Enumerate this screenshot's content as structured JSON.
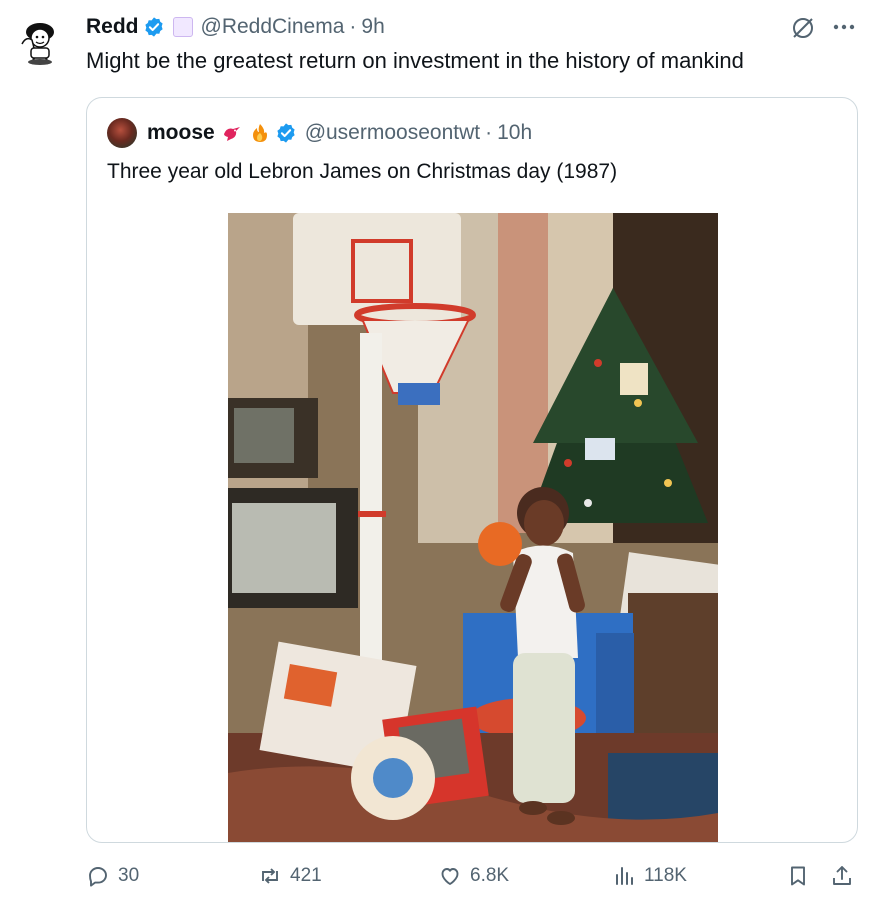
{
  "tweet": {
    "author_name": "Redd",
    "handle": "@ReddCinema",
    "separator": "·",
    "time": "9h",
    "text": "Might be the greatest return on investment in the history of mankind"
  },
  "quote": {
    "author_name": "moose",
    "handle": "@usermooseontwt",
    "separator": "·",
    "time": "10h",
    "text": "Three year old Lebron James on Christmas day (1987)"
  },
  "actions": {
    "replies": "30",
    "reposts": "421",
    "likes": "6.8K",
    "views": "118K"
  },
  "icons": [
    "avatar-cartoon-icon",
    "verified-badge-icon",
    "affiliate-badge-icon",
    "grok-icon",
    "more-icon",
    "bird-emoji-icon",
    "fire-emoji-icon",
    "reply-icon",
    "repost-icon",
    "like-icon",
    "views-icon",
    "bookmark-icon",
    "share-icon"
  ],
  "colors": {
    "accent": "#1d9bf0",
    "muted": "#536471",
    "border": "#cfd9de"
  }
}
